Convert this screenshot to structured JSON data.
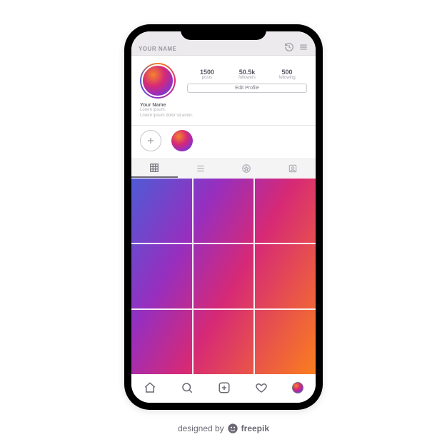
{
  "header": {
    "title": "YOUR NAME"
  },
  "profile": {
    "stats": [
      {
        "num": "1500",
        "label": "posts"
      },
      {
        "num": "50.5k",
        "label": "followers"
      },
      {
        "num": "500",
        "label": "following"
      }
    ],
    "edit_button": "Edit Profile",
    "bio_name": "Your Name",
    "bio_line1": "Lorem ipsum.",
    "bio_line2": "Lorem ipsum dolor sit amet."
  },
  "credit": {
    "prefix": "designed by",
    "brand": "freepik"
  }
}
